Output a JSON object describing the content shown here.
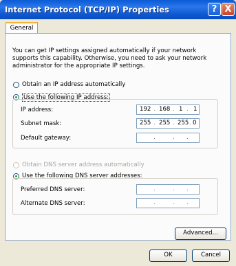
{
  "window": {
    "title": "Internet Protocol (TCP/IP) Properties",
    "help_label": "?",
    "close_label": "X"
  },
  "tabs": [
    "General"
  ],
  "intro_text": "You can get IP settings assigned automatically if your network supports this capability. Otherwise, you need to ask your network administrator for the appropriate IP settings.",
  "ip_mode": {
    "auto_label": "Obtain an IP address automatically",
    "manual_label": "Use the following IP address:",
    "selected": "manual"
  },
  "ip_fields": [
    {
      "label": "IP address:",
      "octets": [
        "192",
        "168",
        "1",
        "1"
      ]
    },
    {
      "label": "Subnet mask:",
      "octets": [
        "255",
        "255",
        "255",
        "0"
      ]
    },
    {
      "label": "Default gateway:",
      "octets": [
        "",
        "",
        "",
        ""
      ]
    }
  ],
  "dns_mode": {
    "auto_label": "Obtain DNS server address automatically",
    "manual_label": "Use the following DNS server addresses:",
    "selected": "manual"
  },
  "dns_fields": [
    {
      "label": "Preferred DNS server:",
      "octets": [
        "",
        "",
        "",
        ""
      ]
    },
    {
      "label": "Alternate DNS server:",
      "octets": [
        "",
        "",
        "",
        ""
      ]
    }
  ],
  "buttons": {
    "advanced": "Advanced...",
    "ok": "OK",
    "cancel": "Cancel"
  }
}
